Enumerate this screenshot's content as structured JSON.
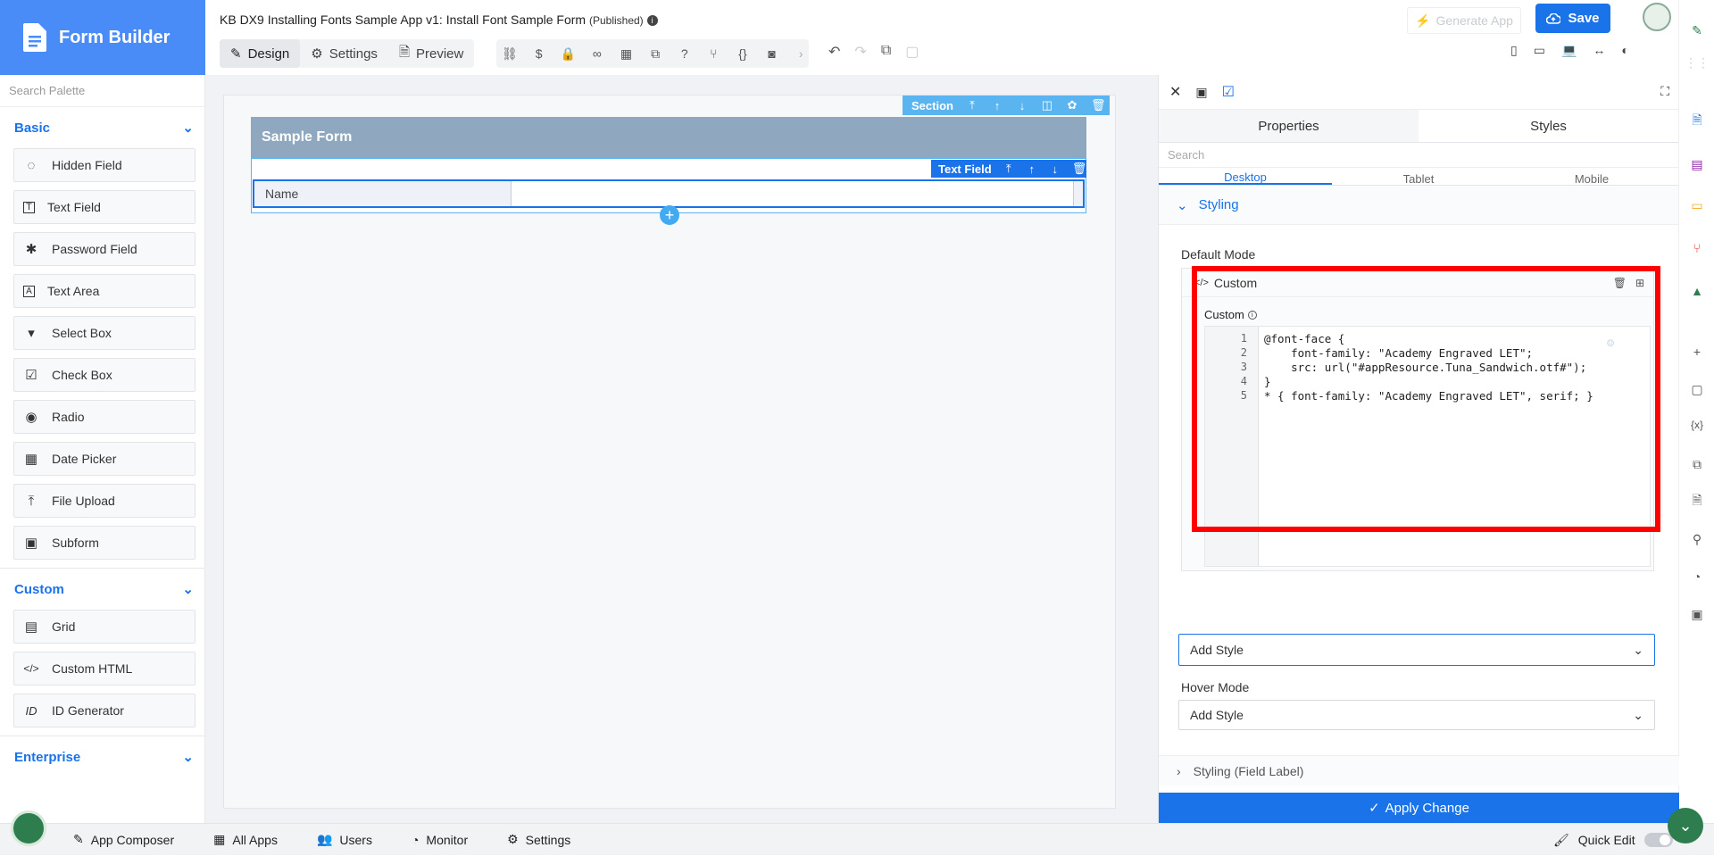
{
  "brand": {
    "title": "Form Builder"
  },
  "header": {
    "app_title": "KB DX9 Installing Fonts Sample App v1: Install Font Sample Form",
    "status": "(Published)",
    "tabs": [
      {
        "label": "Design"
      },
      {
        "label": "Settings"
      },
      {
        "label": "Preview"
      }
    ],
    "generate_label": "Generate App",
    "save_label": "Save"
  },
  "palette": {
    "search_placeholder": "Search Palette",
    "basic": {
      "label": "Basic",
      "items": [
        {
          "label": "Hidden Field",
          "icon": "eye-slash-icon"
        },
        {
          "label": "Text Field",
          "icon": "text-t-icon"
        },
        {
          "label": "Password Field",
          "icon": "asterisk-icon"
        },
        {
          "label": "Text Area",
          "icon": "text-a-icon"
        },
        {
          "label": "Select Box",
          "icon": "dropdown-icon"
        },
        {
          "label": "Check Box",
          "icon": "checkbox-icon"
        },
        {
          "label": "Radio",
          "icon": "radio-icon"
        },
        {
          "label": "Date Picker",
          "icon": "calendar-icon"
        },
        {
          "label": "File Upload",
          "icon": "upload-icon"
        },
        {
          "label": "Subform",
          "icon": "subform-icon"
        }
      ]
    },
    "custom": {
      "label": "Custom",
      "items": [
        {
          "label": "Grid",
          "icon": "grid-icon"
        },
        {
          "label": "Custom HTML",
          "icon": "code-icon"
        },
        {
          "label": "ID Generator",
          "icon": "id-icon"
        }
      ]
    },
    "enterprise": {
      "label": "Enterprise"
    }
  },
  "canvas": {
    "section_label": "Section",
    "form_title": "Sample Form",
    "textfield_label": "Text Field",
    "field_name": "Name"
  },
  "panel": {
    "tabs": [
      {
        "label": "Properties"
      },
      {
        "label": "Styles"
      }
    ],
    "search_placeholder": "Search",
    "device_tabs": [
      {
        "label": "Desktop"
      },
      {
        "label": "Tablet"
      },
      {
        "label": "Mobile"
      }
    ],
    "styling_label": "Styling",
    "default_mode_label": "Default Mode",
    "custom_header": "Custom",
    "custom_label": "Custom",
    "code_lines": [
      {
        "num": "1",
        "text": "@font-face {"
      },
      {
        "num": "2",
        "text": "    font-family: \"Academy Engraved LET\";"
      },
      {
        "num": "3",
        "text": "    src: url(\"#appResource.Tuna_Sandwich.otf#\");"
      },
      {
        "num": "4",
        "text": "}"
      },
      {
        "num": "5",
        "text": "* { font-family: \"Academy Engraved LET\", serif; }"
      }
    ],
    "add_style_label": "Add Style",
    "hover_mode_label": "Hover Mode",
    "hover_add_style_label": "Add Style",
    "styling_field_label": "Styling (Field Label)",
    "apply_label": "Apply Change"
  },
  "bottombar": {
    "items": [
      {
        "label": "App Composer"
      },
      {
        "label": "All Apps"
      },
      {
        "label": "Users"
      },
      {
        "label": "Monitor"
      },
      {
        "label": "Settings"
      }
    ],
    "quick_edit_label": "Quick Edit"
  },
  "colors": {
    "accent": "#1a73e8",
    "brand": "#4a8cf7",
    "highlight": "#ff0000",
    "section": "#5ab4ef"
  }
}
